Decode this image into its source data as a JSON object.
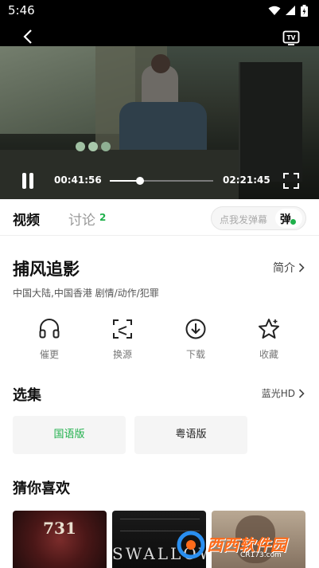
{
  "status_bar": {
    "time": "5:46"
  },
  "player": {
    "current_time": "00:41:56",
    "total_time": "02:21:45",
    "progress_fraction": 0.296,
    "tv_label": "TV"
  },
  "tabs": {
    "video": "视频",
    "discuss": "讨论",
    "discuss_count": "2"
  },
  "danmu": {
    "placeholder": "点我发弹幕",
    "toggle_char": "弹"
  },
  "movie": {
    "title": "捕风追影",
    "intro_label": "简介",
    "meta": "中国大陆,中国香港  剧情/动作/犯罪"
  },
  "actions": [
    {
      "label": "催更",
      "icon": "headphones-icon"
    },
    {
      "label": "换源",
      "icon": "switch-source-icon"
    },
    {
      "label": "下载",
      "icon": "download-icon"
    },
    {
      "label": "收藏",
      "icon": "star-icon"
    }
  ],
  "episodes": {
    "title": "选集",
    "quality": "蓝光HD",
    "items": [
      "国语版",
      "粤语版"
    ],
    "selected_color": "#1fb04b"
  },
  "recommend": {
    "title": "猜你喜欢",
    "posters": [
      "731",
      "SWALLOWS"
    ]
  },
  "watermark": {
    "text": "西西软件园",
    "sub": "CR173.com"
  },
  "colors": {
    "accent": "#1fb04b"
  }
}
